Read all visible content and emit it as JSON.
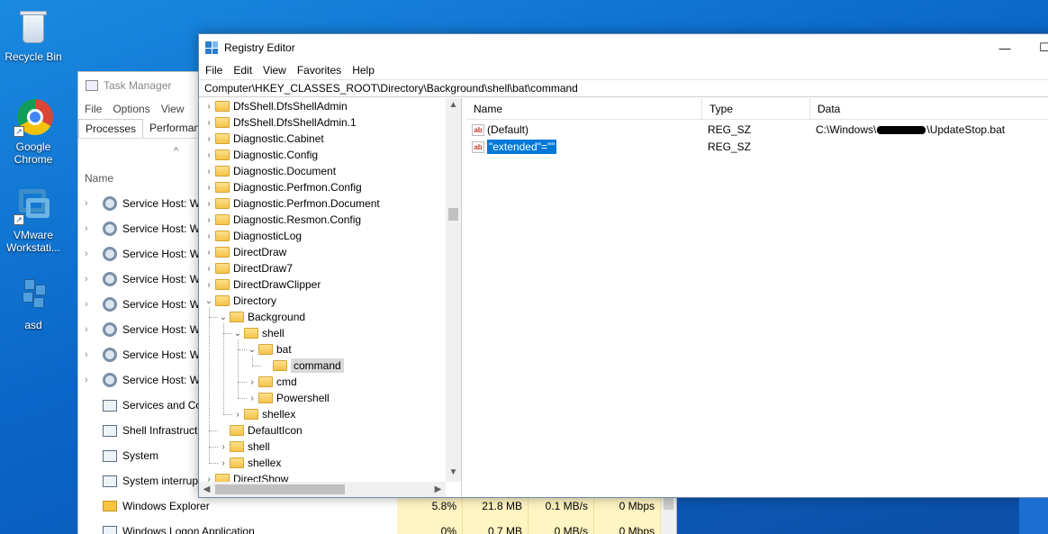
{
  "desktop": {
    "icons": [
      {
        "label": "Recycle Bin"
      },
      {
        "label": "Google Chrome"
      },
      {
        "label": "VMware Workstati..."
      },
      {
        "label": "asd"
      }
    ]
  },
  "task_manager": {
    "title": "Task Manager",
    "menu": [
      "File",
      "Options",
      "View"
    ],
    "tabs": [
      "Processes",
      "Performanc"
    ],
    "sort_arrow": "^",
    "column_name": "Name",
    "rows": [
      {
        "name": "Service Host: W",
        "icon": "gear-icon",
        "expandable": true
      },
      {
        "name": "Service Host: W",
        "icon": "gear-icon",
        "expandable": true
      },
      {
        "name": "Service Host: W",
        "icon": "gear-icon",
        "expandable": true
      },
      {
        "name": "Service Host: W",
        "icon": "gear-icon",
        "expandable": true
      },
      {
        "name": "Service Host: W",
        "icon": "gear-icon",
        "expandable": true
      },
      {
        "name": "Service Host: W",
        "icon": "gear-icon",
        "expandable": true
      },
      {
        "name": "Service Host: W",
        "icon": "gear-icon",
        "expandable": true
      },
      {
        "name": "Service Host: W",
        "icon": "gear-icon",
        "expandable": true
      },
      {
        "name": "Services and Co",
        "icon": "service-icon",
        "expandable": false
      },
      {
        "name": "Shell Infrastruct",
        "icon": "service-icon",
        "expandable": false
      },
      {
        "name": "System",
        "icon": "service-icon",
        "expandable": false
      },
      {
        "name": "System interrup",
        "icon": "service-icon",
        "expandable": false
      },
      {
        "name": "Windows Explorer",
        "icon": "folder-icon",
        "expandable": false,
        "cpu": "5.8%",
        "memory": "21.8 MB",
        "disk": "0.1 MB/s",
        "network": "0 Mbps"
      },
      {
        "name": "Windows Logon Application",
        "icon": "service-icon",
        "expandable": false,
        "cpu": "0%",
        "memory": "0.7 MB",
        "disk": "0 MB/s",
        "network": "0 Mbps"
      }
    ]
  },
  "registry_editor": {
    "title": "Registry Editor",
    "window_controls": {
      "minimize": "—",
      "maximize": "☐"
    },
    "menu": [
      "File",
      "Edit",
      "View",
      "Favorites",
      "Help"
    ],
    "address": "Computer\\HKEY_CLASSES_ROOT\\Directory\\Background\\shell\\bat\\command",
    "tree": [
      {
        "label": "DfsShell.DfsShellAdmin",
        "level": 0,
        "toggle": "›"
      },
      {
        "label": "DfsShell.DfsShellAdmin.1",
        "level": 0,
        "toggle": "›"
      },
      {
        "label": "Diagnostic.Cabinet",
        "level": 0,
        "toggle": "›"
      },
      {
        "label": "Diagnostic.Config",
        "level": 0,
        "toggle": "›"
      },
      {
        "label": "Diagnostic.Document",
        "level": 0,
        "toggle": "›"
      },
      {
        "label": "Diagnostic.Perfmon.Config",
        "level": 0,
        "toggle": "›"
      },
      {
        "label": "Diagnostic.Perfmon.Document",
        "level": 0,
        "toggle": "›"
      },
      {
        "label": "Diagnostic.Resmon.Config",
        "level": 0,
        "toggle": "›"
      },
      {
        "label": "DiagnosticLog",
        "level": 0,
        "toggle": "›"
      },
      {
        "label": "DirectDraw",
        "level": 0,
        "toggle": "›"
      },
      {
        "label": "DirectDraw7",
        "level": 0,
        "toggle": "›"
      },
      {
        "label": "DirectDrawClipper",
        "level": 0,
        "toggle": "›"
      },
      {
        "label": "Directory",
        "level": 0,
        "toggle": "⌄"
      },
      {
        "label": "Background",
        "level": 1,
        "toggle": "⌄"
      },
      {
        "label": "shell",
        "level": 2,
        "toggle": "⌄"
      },
      {
        "label": "bat",
        "level": 3,
        "toggle": "⌄"
      },
      {
        "label": "command",
        "level": 4,
        "toggle": "",
        "selected": true
      },
      {
        "label": "cmd",
        "level": 3,
        "toggle": "›"
      },
      {
        "label": "Powershell",
        "level": 3,
        "toggle": "›"
      },
      {
        "label": "shellex",
        "level": 2,
        "toggle": "›"
      },
      {
        "label": "DefaultIcon",
        "level": 1,
        "toggle": ""
      },
      {
        "label": "shell",
        "level": 1,
        "toggle": "›"
      },
      {
        "label": "shellex",
        "level": 1,
        "toggle": "›"
      },
      {
        "label": "DirectShow",
        "level": 0,
        "toggle": "›"
      }
    ],
    "list_columns": {
      "name": "Name",
      "type": "Type",
      "data": "Data"
    },
    "values": [
      {
        "icon": "ab",
        "name": "(Default)",
        "type": "REG_SZ",
        "data_prefix": "C:\\Windows\\",
        "data_suffix": "\\UpdateStop.bat",
        "redacted": true
      },
      {
        "icon": "ab",
        "name": "\"extended\"=\"\"",
        "type": "REG_SZ",
        "data_prefix": "",
        "data_suffix": "",
        "redacted": false,
        "selected": true
      }
    ]
  }
}
